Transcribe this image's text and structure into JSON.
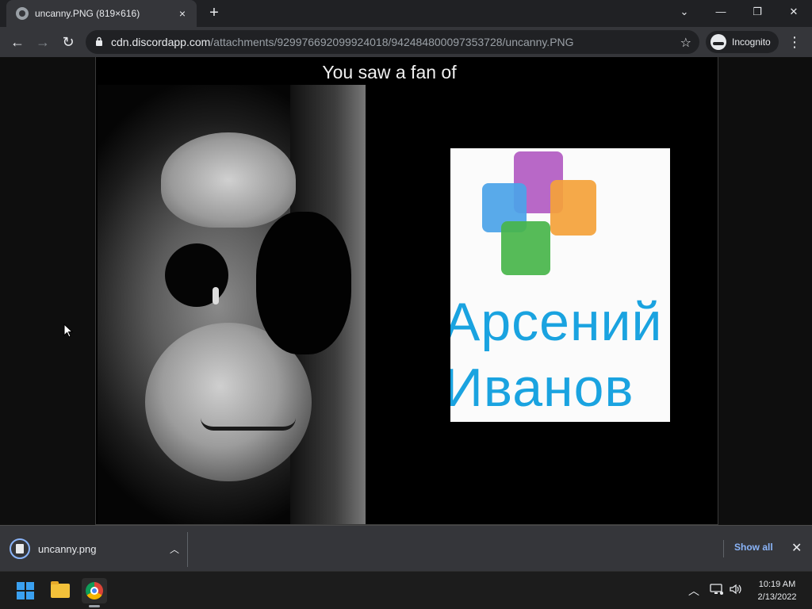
{
  "tab": {
    "title": "uncanny.PNG (819×616)",
    "close_icon": "×",
    "new_tab_icon": "+"
  },
  "window_controls": {
    "dropdown": "⌄",
    "minimize": "—",
    "restore": "❐",
    "close": "✕"
  },
  "toolbar": {
    "back_icon": "←",
    "forward_icon": "→",
    "reload_icon": "↻",
    "url_host": "cdn.discordapp.com",
    "url_path": "/attachments/929976692099924018/942484800097353728/uncanny.PNG",
    "star_icon": "☆",
    "incognito_label": "Incognito",
    "menu_icon": "⋮"
  },
  "image": {
    "caption": "You saw a fan of",
    "logo_line1": "Арсений",
    "logo_line2": "Иванов"
  },
  "download_shelf": {
    "filename": "uncanny.png",
    "caret_icon": "︿",
    "show_all_label": "Show all",
    "close_icon": "✕"
  },
  "taskbar": {
    "tray_chevron": "︿",
    "network_icon": "🖧",
    "volume_icon": "🔊",
    "time": "10:19 AM",
    "date": "2/13/2022"
  }
}
